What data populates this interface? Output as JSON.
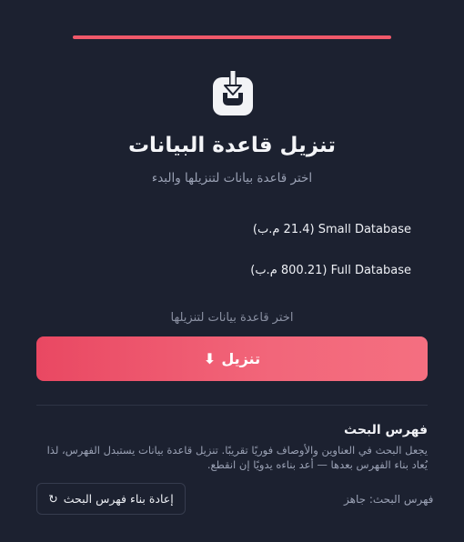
{
  "app": {
    "title": "تنزيل قاعدة البيانات",
    "subtitle": "اختر قاعدة بيانات لتنزيلها والبدء"
  },
  "databases": [
    {
      "label": "Small Database (21.4 م.ب)"
    },
    {
      "label": "Full Database (800.21 م.ب)"
    }
  ],
  "hint": "اختر قاعدة بيانات لتنزيلها",
  "download_button": {
    "icon": "download-arrow-icon",
    "glyph": "⬇",
    "label": "تنزيل"
  },
  "search_index": {
    "title": "فهرس البحث",
    "description": "يجعل البحث في العناوين والأوصاف فوريًا تقريبًا. تنزيل قاعدة بيانات يستبدل الفهرس، لذا يُعاد بناء الفهرس بعدها — أعد بناءه يدويًا إن انقطع.",
    "status": "فهرس البحث: جاهز",
    "rebuild_button": {
      "icon": "refresh-icon",
      "glyph": "↻",
      "label": "إعادة بناء فهرس البحث"
    }
  },
  "colors": {
    "background": "#1c2130",
    "accent": "#f0596a"
  }
}
